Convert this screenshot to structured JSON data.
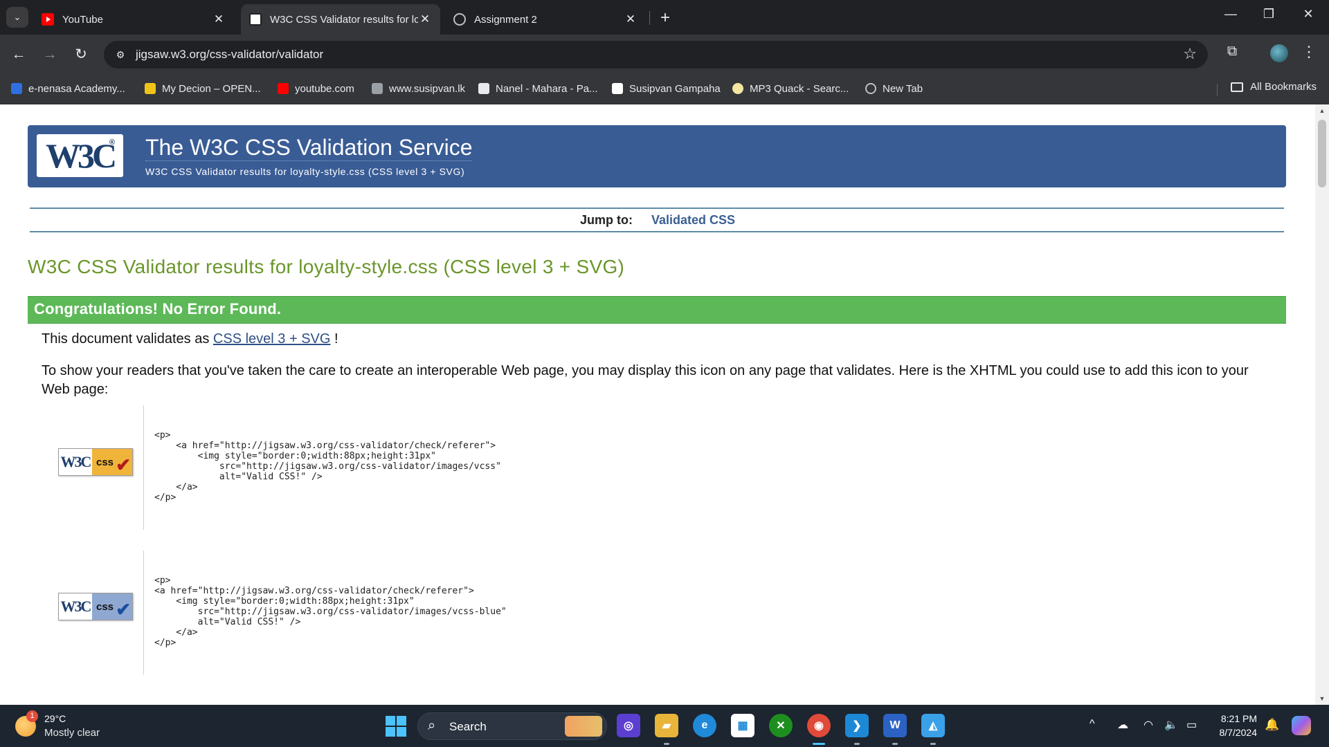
{
  "browser": {
    "tabs": [
      {
        "title": "YouTube",
        "favicon": "youtube-icon",
        "active": false
      },
      {
        "title": "W3C CSS Validator results for lo",
        "favicon": "w3c-favicon-icon",
        "active": true
      },
      {
        "title": "Assignment 2",
        "favicon": "globe-icon",
        "active": false
      }
    ],
    "tab_close_glyph": "✕",
    "new_tab_glyph": "+",
    "window_controls": {
      "minimize": "—",
      "restore": "❐",
      "close": "✕"
    },
    "nav": {
      "back": "←",
      "forward": "→",
      "reload": "↻"
    },
    "url": "jigsaw.w3.org/css-validator/validator",
    "bookmarks": [
      {
        "label": "e-nenasa Academy...",
        "icon_color": "#2f6fe0"
      },
      {
        "label": "My Decion – OPEN...",
        "icon_color": "#f0c419"
      },
      {
        "label": "youtube.com",
        "icon_color": "#ff0000"
      },
      {
        "label": "www.susipvan.lk",
        "icon_color": "#9aa0a6"
      },
      {
        "label": "Nanel - Mahara - Pa...",
        "icon_color": "#e8eaed"
      },
      {
        "label": "Susipvan Gampaha",
        "icon_color": "#ffffff"
      },
      {
        "label": "MP3 Quack - Searc...",
        "icon_color": "#f4e6a1"
      },
      {
        "label": "New Tab",
        "icon_color": "#bdc1c6"
      }
    ],
    "all_bookmarks": "All Bookmarks"
  },
  "page": {
    "banner": {
      "logo_text": "W3C",
      "logo_mark": "®",
      "title": "The W3C CSS Validation Service",
      "subtitle": "W3C CSS Validator results for loyalty-style.css (CSS level 3 + SVG)"
    },
    "jump_label": "Jump to:",
    "jump_link": "Validated CSS",
    "results_title": "W3C CSS Validator results for loyalty-style.css (CSS level 3 + SVG)",
    "congrats": "Congratulations! No Error Found.",
    "validates_prefix": "This document validates as",
    "validates_link": "CSS level 3 + SVG",
    "validates_suffix": "!",
    "icon_paragraph": "To show your readers that you've taken the care to create an interoperable Web page, you may display this icon on any page that validates. Here is the XHTML you could use to add this icon to your Web page:",
    "badges": [
      {
        "variant": "gold",
        "w3c": "W3C",
        "css": "css",
        "check": "✔",
        "code": "<p>\n    <a href=\"http://jigsaw.w3.org/css-validator/check/referer\">\n        <img style=\"border:0;width:88px;height:31px\"\n            src=\"http://jigsaw.w3.org/css-validator/images/vcss\"\n            alt=\"Valid CSS!\" />\n    </a>\n</p>"
      },
      {
        "variant": "blue",
        "w3c": "W3C",
        "css": "css",
        "check": "✔",
        "code": "<p>\n<a href=\"http://jigsaw.w3.org/css-validator/check/referer\">\n    <img style=\"border:0;width:88px;height:31px\"\n        src=\"http://jigsaw.w3.org/css-validator/images/vcss-blue\"\n        alt=\"Valid CSS!\" />\n    </a>\n</p>"
      }
    ]
  },
  "taskbar": {
    "weather": {
      "temp": "29°C",
      "desc": "Mostly clear",
      "badge": "1"
    },
    "search_label": "Search",
    "apps": [
      {
        "name": "copilot-app-icon",
        "glyph": "◎",
        "color": "#5b3fd1",
        "running": false
      },
      {
        "name": "file-explorer-icon",
        "glyph": "▰",
        "color": "#e8b43a",
        "running": true
      },
      {
        "name": "edge-icon",
        "glyph": "e",
        "color": "#1f8ad8",
        "running": false
      },
      {
        "name": "store-icon",
        "glyph": "▦",
        "color": "#ffffff",
        "running": false
      },
      {
        "name": "xbox-icon",
        "glyph": "✕",
        "color": "#1e8f1e",
        "running": false
      },
      {
        "name": "chrome-icon",
        "glyph": "◉",
        "color": "#e04a3a",
        "running": true
      },
      {
        "name": "vscode-icon",
        "glyph": "❯",
        "color": "#1d88d6",
        "running": true
      },
      {
        "name": "word-icon",
        "glyph": "W",
        "color": "#2b62c3",
        "running": true
      },
      {
        "name": "photos-icon",
        "glyph": "◭",
        "color": "#3aa0e8",
        "running": true
      }
    ],
    "tray": {
      "chevron": "^",
      "onedrive": "☁",
      "wifi": "◠",
      "volume": "🔈"
    },
    "time": "8:21 PM",
    "date": "8/7/2024"
  }
}
